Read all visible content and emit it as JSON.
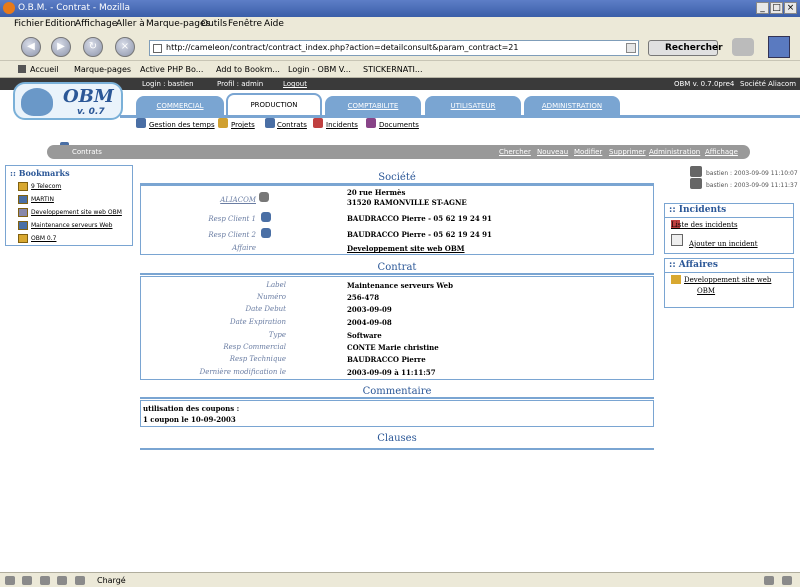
{
  "window": {
    "title": "O.B.M. - Contrat - Mozilla"
  },
  "menu": [
    "Fichier",
    "Edition",
    "Affichage",
    "Aller à",
    "Marque-pages",
    "Outils",
    "Fenêtre",
    "Aide"
  ],
  "nav": {
    "url": "http://cameleon/contract/contract_index.php?action=detailconsult&param_contract=21",
    "search_label": "Rechercher"
  },
  "personal_toolbar": [
    "Accueil",
    "Marque-pages",
    "Active PHP Bo...",
    "Add to Bookm...",
    "Login - OBM V...",
    "STICKERNATI..."
  ],
  "obm": {
    "login": "Login : bastien",
    "profile": "Profil : admin",
    "logout": "Logout",
    "version_text": "OBM v. 0.7.0pre4",
    "company": "Société Aliacom",
    "logo_name": "OBM",
    "logo_version": "v. 0.7",
    "tabs": [
      "COMMERCIAL",
      "PRODUCTION",
      "COMPTABILITE",
      "UTILISATEUR",
      "ADMINISTRATION"
    ],
    "subnav": [
      "Gestion des temps",
      "Projets",
      "Contrats",
      "Incidents",
      "Documents"
    ],
    "crumb": "Contrats",
    "actions": [
      "Chercher",
      "Nouveau",
      "Modifier",
      "Supprimer",
      "Administration",
      "Affichage"
    ]
  },
  "bookmarks": {
    "title": ":: Bookmarks",
    "items": [
      "9 Telecom",
      "MARTIN",
      "Developpement site web OBM",
      "Maintenance serveurs Web",
      "OBM 0.7"
    ]
  },
  "societe": {
    "title": "Société",
    "company": "ALIACOM",
    "address1": "20 rue Hermès",
    "address2": "31520 RAMONVILLE ST-AGNE",
    "resp1_label": "Resp Client 1",
    "resp1": "BAUDRACCO Pierre - 05 62 19 24 91",
    "resp2_label": "Resp Client 2",
    "resp2": "BAUDRACCO Pierre - 05 62 19 24 91",
    "affaire_label": "Affaire",
    "affaire": "Developpement site web OBM"
  },
  "contrat": {
    "title": "Contrat",
    "fields": [
      {
        "label": "Label",
        "value": "Maintenance serveurs Web"
      },
      {
        "label": "Numéro",
        "value": "256-478"
      },
      {
        "label": "Date Debut",
        "value": "2003-09-09"
      },
      {
        "label": "Date Expiration",
        "value": "2004-09-08"
      },
      {
        "label": "Type",
        "value": "Software"
      },
      {
        "label": "Resp Commercial",
        "value": "CONTE Marie christine"
      },
      {
        "label": "Resp Technique",
        "value": "BAUDRACCO Pierre"
      },
      {
        "label": "Dernière modification le",
        "value": "2003-09-09 à 11:11:57"
      }
    ]
  },
  "commentaire": {
    "title": "Commentaire",
    "line1": "utilisation des coupons :",
    "line2": "1 coupon le 10-09-2003"
  },
  "clauses": {
    "title": "Clauses"
  },
  "updates": [
    "bastien : 2003-09-09 11:10:07",
    "bastien : 2003-09-09 11:11:37"
  ],
  "incidents": {
    "title": ":: Incidents",
    "list": "Liste des incidents",
    "add": "Ajouter un incident"
  },
  "affaires": {
    "title": ":: Affaires",
    "line1": "Developpement site web",
    "line2": "OBM"
  },
  "status": {
    "text": "Chargé"
  }
}
